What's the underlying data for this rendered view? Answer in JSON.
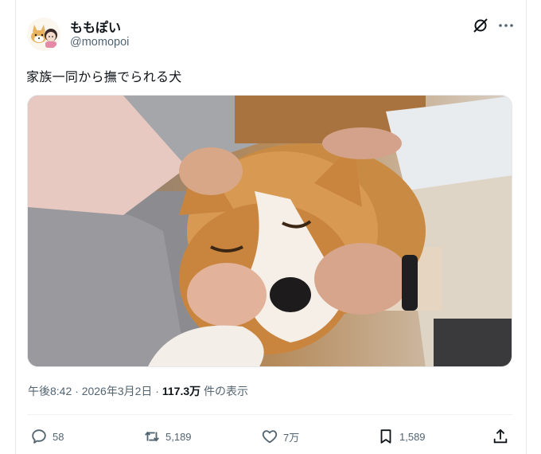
{
  "user": {
    "display_name": "ももぽい",
    "handle": "@momopoi"
  },
  "tweet": {
    "text": "家族一同から撫でられる犬"
  },
  "meta": {
    "time": "午後8:42",
    "sep1": " · ",
    "date": "2026年3月2日",
    "sep2": " · ",
    "views": "117.3万",
    "views_label": " 件の表示"
  },
  "actions": {
    "replies": "58",
    "reposts": "5,189",
    "likes": "7万",
    "bookmarks": "1,589"
  },
  "icons": {
    "grok": "grok-icon",
    "more": "more-icon",
    "reply": "reply-icon",
    "repost": "repost-icon",
    "like": "heart-icon",
    "bookmark": "bookmark-icon",
    "share": "share-icon"
  },
  "colors": {
    "text": "#0f1419",
    "secondary": "#536471"
  }
}
